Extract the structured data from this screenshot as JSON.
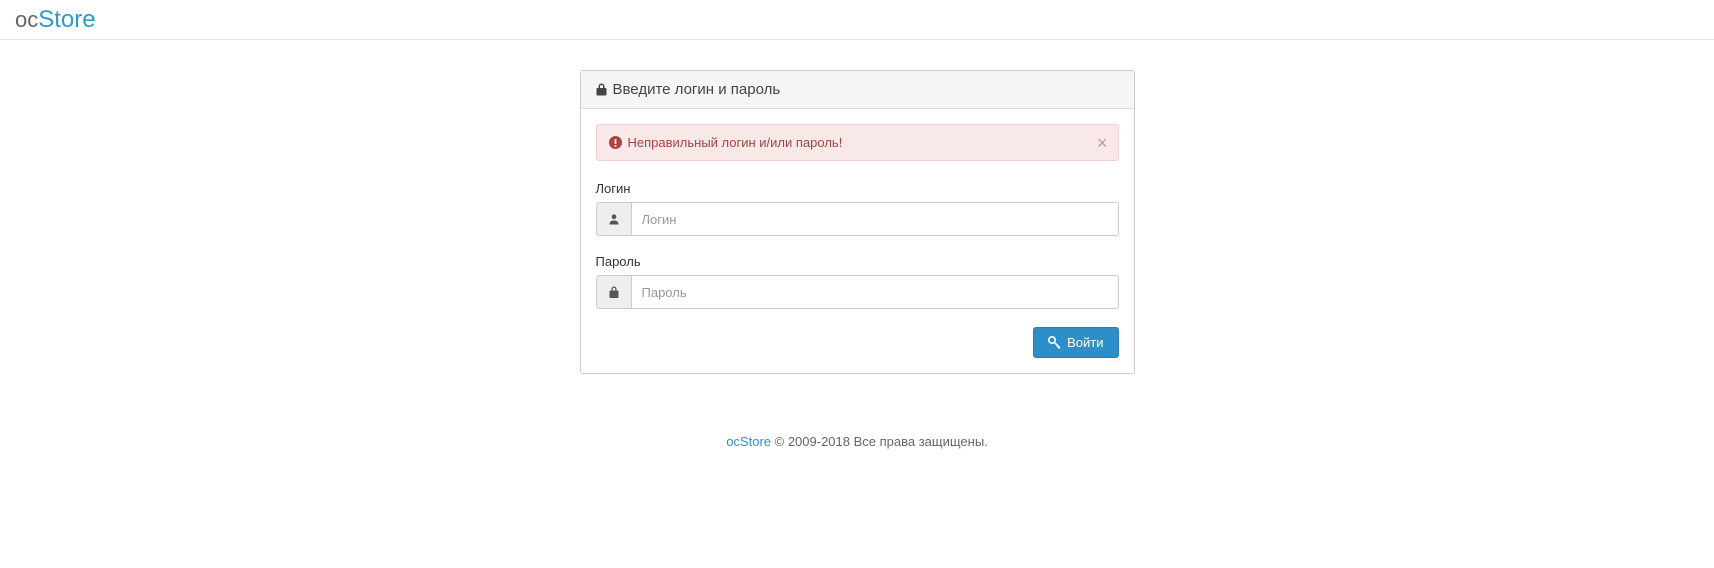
{
  "brand": {
    "prefix": "oc",
    "suffix": "Store"
  },
  "panel": {
    "title": "Введите логин и пароль"
  },
  "alert": {
    "message": "Неправильный логин и/или пароль!"
  },
  "form": {
    "login": {
      "label": "Логин",
      "placeholder": "Логин",
      "value": ""
    },
    "password": {
      "label": "Пароль",
      "placeholder": "Пароль",
      "value": ""
    },
    "submit": "Войти"
  },
  "footer": {
    "link": "ocStore",
    "rest": " © 2009-2018 Все права защищены."
  }
}
